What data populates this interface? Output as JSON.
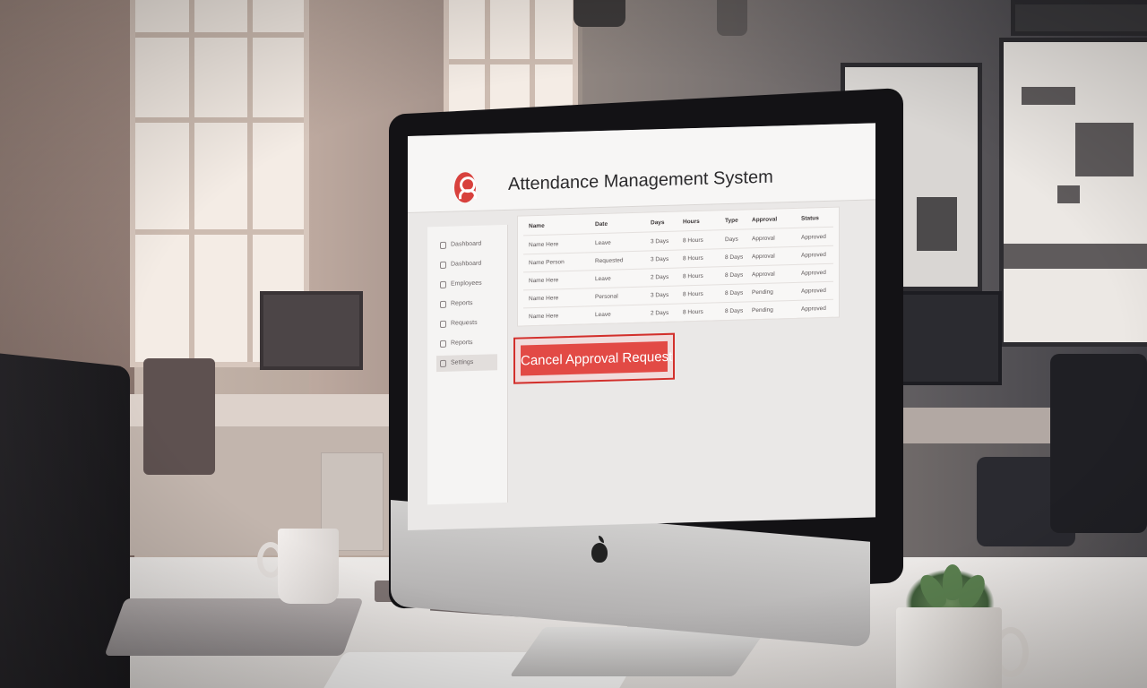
{
  "app": {
    "title": "Attendance Management System",
    "logo_icon": "user-pin-icon",
    "accent_color": "#d8413d"
  },
  "sidebar": {
    "items": [
      {
        "label": "Dashboard",
        "icon": "user-icon"
      },
      {
        "label": "Dashboard",
        "icon": "lock-icon"
      },
      {
        "label": "Employees",
        "icon": "document-icon"
      },
      {
        "label": "Reports",
        "icon": "document-icon"
      },
      {
        "label": "Requests",
        "icon": "document-icon"
      },
      {
        "label": "Reports",
        "icon": "user-icon"
      },
      {
        "label": "Settings",
        "icon": "gear-icon"
      }
    ]
  },
  "table": {
    "headers": [
      "Name",
      "Date",
      "Days",
      "Hours",
      "Type",
      "Approval",
      "Status"
    ],
    "rows": [
      [
        "Name Here",
        "Leave",
        "3 Days",
        "8 Hours",
        "Days",
        "Approval",
        "Approved"
      ],
      [
        "Name Person",
        "Requested",
        "3 Days",
        "8 Hours",
        "8 Days",
        "Approval",
        "Approved"
      ],
      [
        "Name Here",
        "Leave",
        "2 Days",
        "8 Hours",
        "8 Days",
        "Approval",
        "Approved"
      ],
      [
        "Name Here",
        "Personal",
        "3 Days",
        "8 Hours",
        "8 Days",
        "Pending",
        "Approved"
      ],
      [
        "Name Here",
        "Leave",
        "2 Days",
        "8 Hours",
        "8 Days",
        "Pending",
        "Approved"
      ]
    ]
  },
  "actions": {
    "cancel_label": "Cancel Approval Request"
  }
}
